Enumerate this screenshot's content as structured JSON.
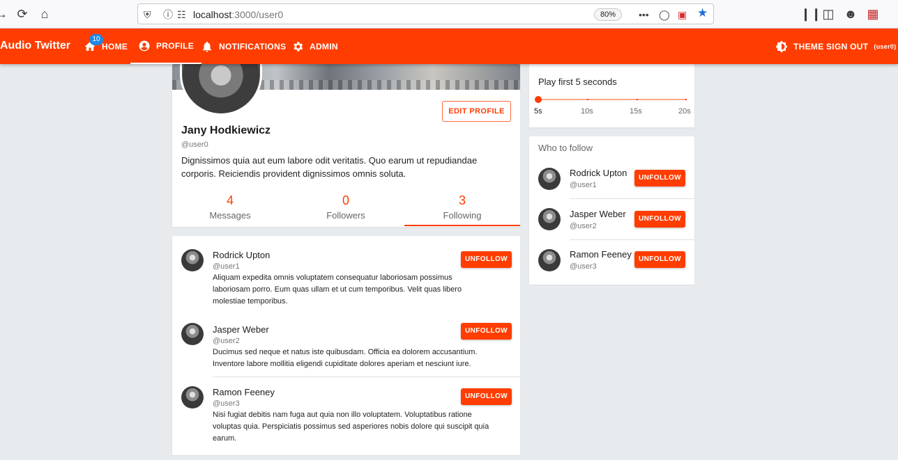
{
  "browser": {
    "url_host": "localhost",
    "url_path": ":3000/user0",
    "zoom": "80%"
  },
  "appbar": {
    "brand": "Audio Twitter",
    "nav": {
      "home": "HOME",
      "home_badge": "10",
      "profile": "PROFILE",
      "notifications": "NOTIFICATIONS",
      "admin": "ADMIN"
    },
    "theme": "THEME",
    "sign_out": "SIGN OUT",
    "sign_out_user": "(user0)",
    "accent_color": "#ff3d00"
  },
  "profile": {
    "name": "Jany Hodkiewicz",
    "handle": "@user0",
    "bio": "Dignissimos quia aut eum labore odit veritatis. Quo earum ut repudiandae corporis. Reiciendis provident dignissimos omnis soluta.",
    "edit_label": "EDIT PROFILE",
    "stats": [
      {
        "value": "4",
        "label": "Messages"
      },
      {
        "value": "0",
        "label": "Followers"
      },
      {
        "value": "3",
        "label": "Following"
      }
    ]
  },
  "following": [
    {
      "name": "Rodrick Upton",
      "handle": "@user1",
      "text": "Aliquam expedita omnis voluptatem consequatur laboriosam possimus laboriosam porro. Eum quas ullam et ut cum temporibus. Velit quas libero molestiae temporibus.",
      "button": "UNFOLLOW"
    },
    {
      "name": "Jasper Weber",
      "handle": "@user2",
      "text": "Ducimus sed neque et natus iste quibusdam. Officia ea dolorem accusantium. Inventore labore mollitia eligendi cupiditate dolores aperiam et nesciunt iure.",
      "button": "UNFOLLOW"
    },
    {
      "name": "Ramon Feeney",
      "handle": "@user3",
      "text": "Nisi fugiat debitis nam fuga aut quia non illo voluptatem. Voluptatibus ratione voluptas quia. Perspiciatis possimus sed asperiores nobis dolore qui suscipit quia earum.",
      "button": "UNFOLLOW"
    }
  ],
  "player": {
    "title": "Play first 5 seconds",
    "marks": [
      "5s",
      "10s",
      "15s",
      "20s"
    ],
    "selected_seconds": 5
  },
  "who_to_follow": {
    "title": "Who to follow",
    "users": [
      {
        "name": "Rodrick Upton",
        "handle": "@user1",
        "button": "UNFOLLOW"
      },
      {
        "name": "Jasper Weber",
        "handle": "@user2",
        "button": "UNFOLLOW"
      },
      {
        "name": "Ramon Feeney",
        "handle": "@user3",
        "button": "UNFOLLOW"
      }
    ]
  }
}
